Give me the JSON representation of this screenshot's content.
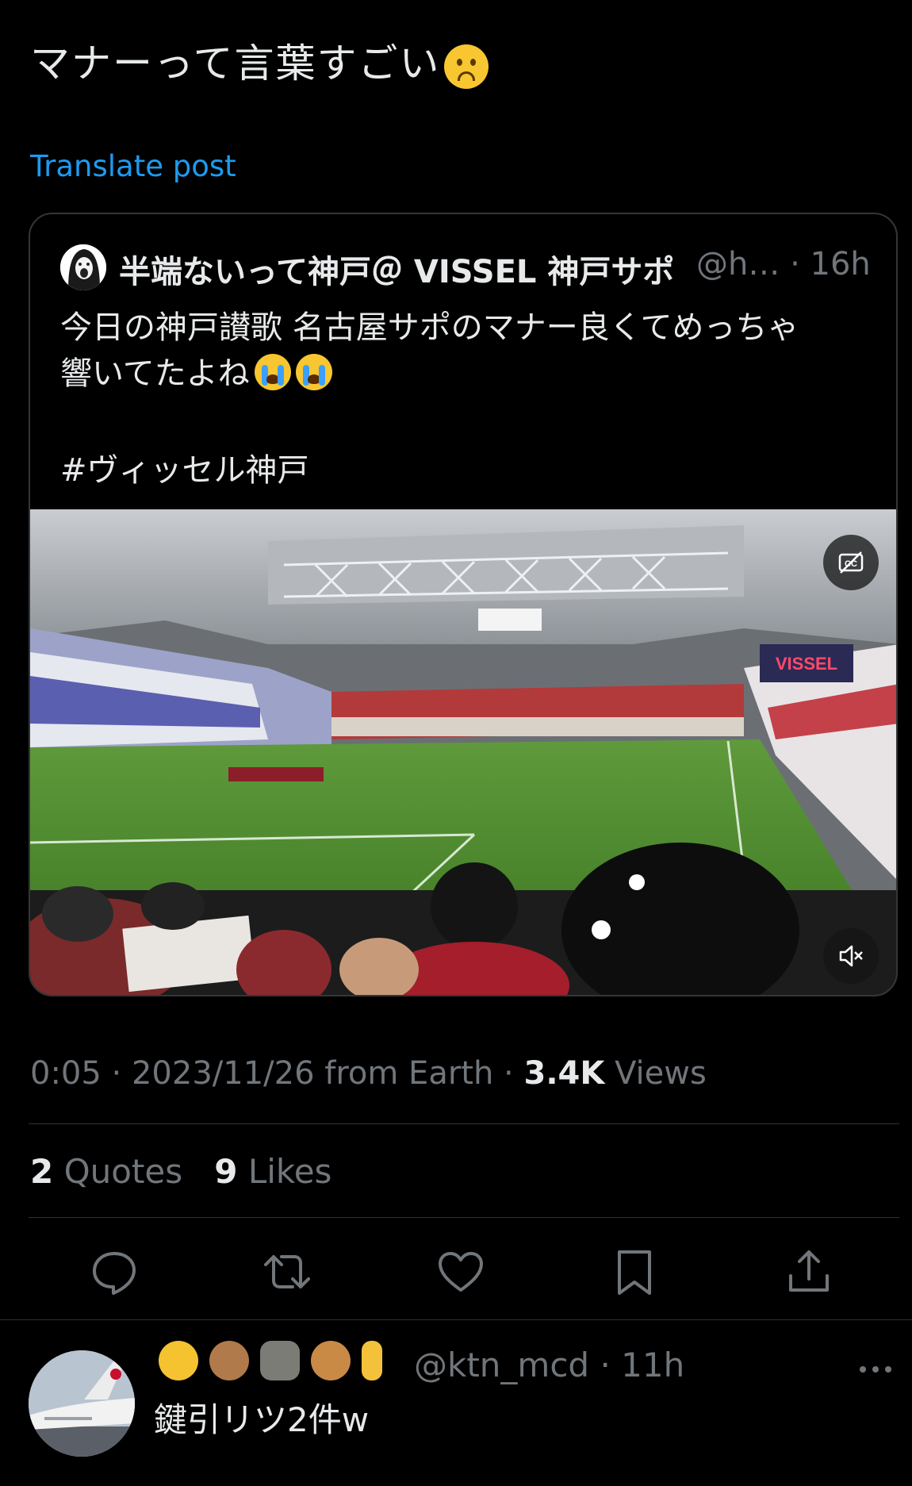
{
  "post": {
    "text": "マナーって言葉すごい",
    "translate_label": "Translate post"
  },
  "quoted": {
    "display_name": "半端ないって神戸＠ VISSEL 神戸サポ",
    "handle": "@h…",
    "time": "· 16h",
    "text_line1": "今日の神戸讃歌 名古屋サポのマナー良くてめっちゃ",
    "text_line2": "響いてたよね",
    "hashtag": "#ヴィッセル神戸",
    "video": {
      "scoreboard_text": "VISSEL"
    }
  },
  "meta": {
    "time": "0:05",
    "date": "2023/11/26",
    "source": "from Earth",
    "views_count": "3.4K",
    "views_label": "Views"
  },
  "stats": {
    "quotes_count": "2",
    "quotes_label": "Quotes",
    "likes_count": "9",
    "likes_label": "Likes"
  },
  "actions": [
    "reply-icon",
    "repost-icon",
    "like-icon",
    "bookmark-icon",
    "share-icon"
  ],
  "reply": {
    "name_emojis": [
      "cat-face",
      "see-no-evil-monkey",
      "moai",
      "teddy-bear",
      "middle-finger"
    ],
    "handle": "@ktn_mcd",
    "time": "· 11h",
    "text": "鍵引リツ2件w"
  },
  "colors": {
    "background": "#000000",
    "text": "#e7e9ea",
    "secondary": "#71767b",
    "link": "#1d9bf0",
    "border": "#2f3336"
  }
}
